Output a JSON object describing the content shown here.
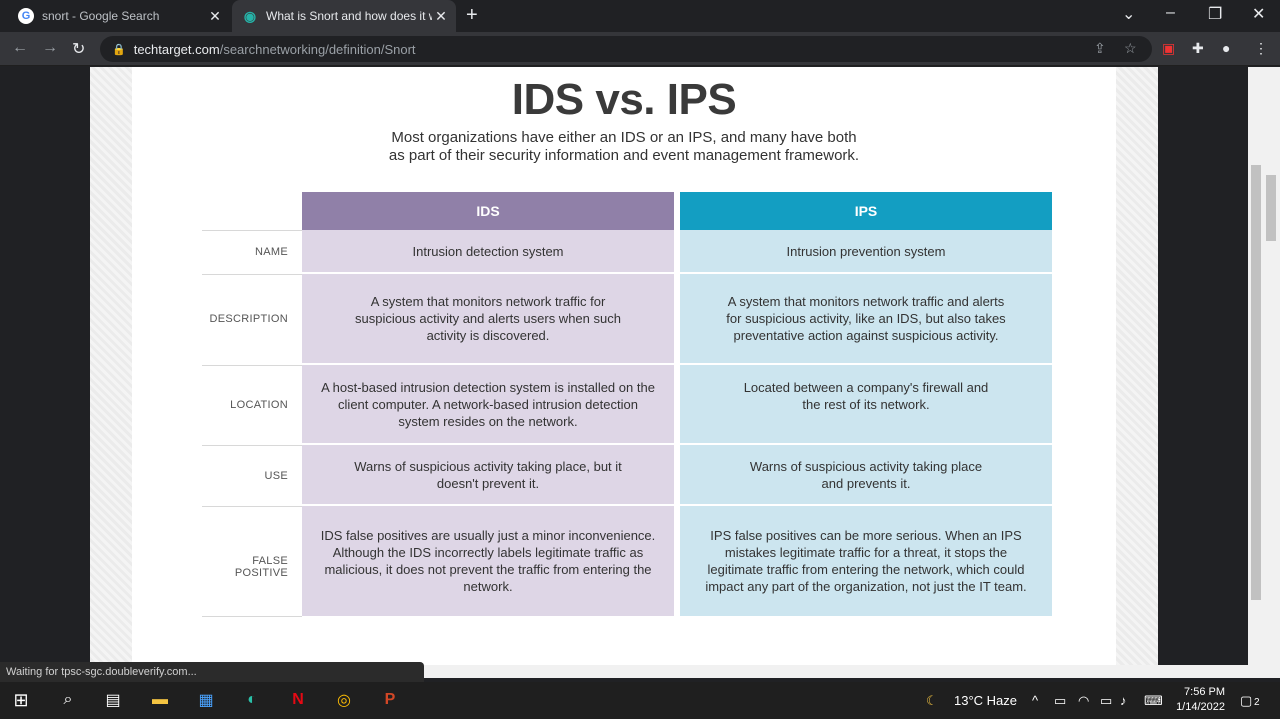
{
  "browser": {
    "tabs": [
      {
        "title": "snort - Google Search",
        "icon": "google-icon"
      },
      {
        "title": "What is Snort and how does it w",
        "icon": "techtarget-icon"
      }
    ],
    "url_host": "techtarget.com",
    "url_path": "/searchnetworking/definition/Snort",
    "status_text": "Waiting for tpsc-sgc.doubleverify.com..."
  },
  "infographic": {
    "title": "IDS vs. IPS",
    "subtitle_line1": "Most organizations have either an IDS or an IPS, and many have both",
    "subtitle_line2": "as part of their security information and event management framework.",
    "col_ids": "IDS",
    "col_ips": "IPS",
    "rows": [
      {
        "label": "NAME",
        "ids": "Intrusion detection system",
        "ips": "Intrusion prevention system"
      },
      {
        "label": "DESCRIPTION",
        "ids": "A system that monitors network traffic for suspicious activity and alerts users when such activity is discovered.",
        "ips": "A system that monitors network traffic and alerts for suspicious activity, like an IDS, but also takes preventative action against suspicious activity."
      },
      {
        "label": "LOCATION",
        "ids": "A host-based intrusion detection system is installed on the client computer. A network-based intrusion detection system resides on the network.",
        "ips": "Located between a company's firewall and the rest of its network."
      },
      {
        "label": "USE",
        "ids": "Warns of suspicious activity taking place, but it doesn't prevent it.",
        "ips": "Warns of suspicious activity taking place and prevents it."
      },
      {
        "label": "FALSE POSITIVE",
        "ids": "IDS false positives are usually just a minor inconvenience. Although the IDS incorrectly labels legitimate traffic as malicious, it does not prevent the traffic from entering the network.",
        "ips": "IPS false positives can be more serious. When an IPS mistakes legitimate traffic for a threat, it stops the legitimate traffic from entering the network, which could impact any part of the organization, not just the IT team."
      }
    ],
    "colors": {
      "ids_header": "#9080a8",
      "ips_header": "#139ec2",
      "ids_cell": "#ded6e6",
      "ips_cell": "#cce5ef"
    }
  },
  "taskbar": {
    "weather": "13°C  Haze",
    "time": "7:56 PM",
    "date": "1/14/2022",
    "notifications": "2"
  }
}
